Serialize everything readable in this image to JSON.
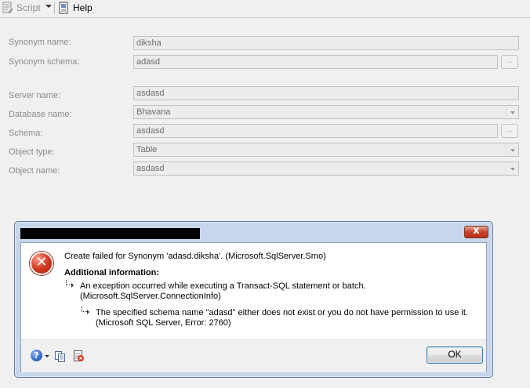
{
  "toolbar": {
    "script_label": "Script",
    "help_label": "Help"
  },
  "form": {
    "synonym_name": {
      "label": "Synonym name:",
      "value": "diksha"
    },
    "synonym_schema": {
      "label": "Synonym schema:",
      "value": "adasd"
    },
    "server_name": {
      "label": "Server name:",
      "value": "asdasd"
    },
    "database_name": {
      "label": "Database name:",
      "value": "Bhavana"
    },
    "schema": {
      "label": "Schema:",
      "value": "asdasd"
    },
    "object_type": {
      "label": "Object type:",
      "value": "Table"
    },
    "object_name": {
      "label": "Object name:",
      "value": "asdasd"
    },
    "browse_label": "..."
  },
  "dialog": {
    "close_glyph": "x",
    "error_glyph": "✕",
    "main_message": "Create failed for Synonym 'adasd.diksha'.  (Microsoft.SqlServer.Smo)",
    "additional_header": "Additional information:",
    "inner1_line1": "An exception occurred while executing a Transact-SQL statement or batch.",
    "inner1_line2": "(Microsoft.SqlServer.ConnectionInfo)",
    "inner2_line1": "The specified schema name \"adasd\" either does not exist or you do not have permission to use it.",
    "inner2_line2": "(Microsoft SQL Server, Error: 2760)",
    "ok_label": "OK",
    "help_glyph": "?"
  }
}
